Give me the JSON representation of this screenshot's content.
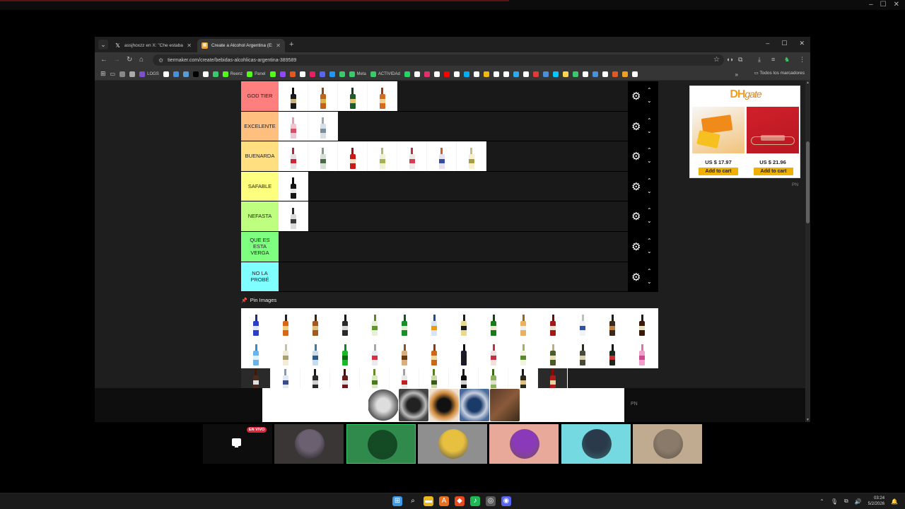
{
  "outer_window": {
    "controls": [
      "–",
      "☐",
      "✕"
    ]
  },
  "browser": {
    "tab_list_glyph": "⌄",
    "tabs": [
      {
        "favicon": "x-logo-icon",
        "title": "assjhoxzz en X: \"Che estaba al",
        "close": "✕"
      },
      {
        "favicon": "tiermaker-icon",
        "title": "Create a Alcohol Argentina (Ex",
        "close": "✕"
      }
    ],
    "new_tab": "+",
    "window_controls": {
      "minimize": "–",
      "maximize": "☐",
      "close": "✕"
    },
    "nav": {
      "back": "←",
      "forward": "→",
      "reload": "↻",
      "home": "⌂"
    },
    "url": "tiermaker.com/create/bebidas-alcohlicas-argentina-389589",
    "star": "☆",
    "bookmarks": [
      {
        "label": "",
        "color": "#888888"
      },
      {
        "label": "",
        "color": "#aaaaaa"
      },
      {
        "label": "LOGS",
        "color": "#7b52c7"
      },
      {
        "label": "",
        "color": "#ffffff"
      },
      {
        "label": "",
        "color": "#4a90d9"
      },
      {
        "label": "",
        "color": "#5b9bd5"
      },
      {
        "label": "",
        "color": "#000000"
      },
      {
        "label": "",
        "color": "#ffffff"
      },
      {
        "label": "",
        "color": "#3ac96b"
      },
      {
        "label": "Reenz",
        "color": "#53fc18"
      },
      {
        "label": "Panel",
        "color": "#53fc18"
      },
      {
        "label": "",
        "color": "#53fc18"
      },
      {
        "label": "",
        "color": "#9146ff"
      },
      {
        "label": "",
        "color": "#e25822"
      },
      {
        "label": "",
        "color": "#ffffff"
      },
      {
        "label": "",
        "color": "#e91e63"
      },
      {
        "label": "",
        "color": "#5865f2"
      },
      {
        "label": "",
        "color": "#2196f3"
      },
      {
        "label": "",
        "color": "#3ac96b"
      },
      {
        "label": "Meta",
        "color": "#3ac96b"
      },
      {
        "label": "ACTIVIDAd",
        "color": "#3ac96b"
      },
      {
        "label": "",
        "color": "#25d366"
      },
      {
        "label": "",
        "color": "#ffffff"
      },
      {
        "label": "",
        "color": "#e1306c"
      },
      {
        "label": "",
        "color": "#ffffff"
      },
      {
        "label": "",
        "color": "#ff0000"
      },
      {
        "label": "",
        "color": "#ffffff"
      },
      {
        "label": "",
        "color": "#00aff0"
      },
      {
        "label": "",
        "color": "#ffffff"
      },
      {
        "label": "",
        "color": "#f0b90b"
      },
      {
        "label": "",
        "color": "#ffffff"
      },
      {
        "label": "",
        "color": "#ffffff"
      },
      {
        "label": "",
        "color": "#2aabee"
      },
      {
        "label": "",
        "color": "#ffffff"
      },
      {
        "label": "",
        "color": "#e53935"
      },
      {
        "label": "",
        "color": "#4a90d9"
      },
      {
        "label": "",
        "color": "#00c8ff"
      },
      {
        "label": "",
        "color": "#ffd54f"
      },
      {
        "label": "",
        "color": "#3ac96b"
      },
      {
        "label": "",
        "color": "#ffffff"
      },
      {
        "label": "",
        "color": "#4a90d9"
      },
      {
        "label": "",
        "color": "#ffffff"
      },
      {
        "label": "",
        "color": "#e25822"
      },
      {
        "label": "",
        "color": "#f0a020"
      },
      {
        "label": "",
        "color": "#ffffff"
      }
    ],
    "bookmarks_overflow": "»",
    "all_bookmarks": "Todos los marcadores"
  },
  "tier_list": {
    "tiers": [
      {
        "label": "GOD TIER",
        "color": "#ff7f7f",
        "items": [
          {
            "cap": "#111111",
            "body": "#1a1a1a",
            "label": "#c9b37a"
          },
          {
            "cap": "#8a4b12",
            "body": "#c0641a",
            "label": "#d8b24a"
          },
          {
            "cap": "#123f1f",
            "body": "#1d5a2a",
            "label": "#e2c26a"
          },
          {
            "cap": "#a03a10",
            "body": "#d86a1e",
            "label": "#f0d08a"
          }
        ]
      },
      {
        "label": "EXCELENTE",
        "color": "#ffbf7f",
        "items": [
          {
            "cap": "#e0a0b0",
            "body": "#f2c4cf",
            "label": "#d84e6a"
          },
          {
            "cap": "#9aa7b4",
            "body": "#d8dee4",
            "label": "#7b8ea0"
          }
        ]
      },
      {
        "label": "BUENARDA",
        "color": "#ffdf7f",
        "items": [
          {
            "cap": "#b0283c",
            "body": "#e8e0e0",
            "label": "#c8283c"
          },
          {
            "cap": "#8a9a8a",
            "body": "#d6e0d6",
            "label": "#4a6a4a"
          },
          {
            "cap": "#a01010",
            "body": "#c81818",
            "label": "#f0e0c0"
          },
          {
            "cap": "#b0b870",
            "body": "#f0f0d8",
            "label": "#a8b050"
          },
          {
            "cap": "#c03040",
            "body": "#f0e8e8",
            "label": "#d04050"
          },
          {
            "cap": "#d06020",
            "body": "#e8e0f0",
            "label": "#3050a0"
          },
          {
            "cap": "#c8c070",
            "body": "#f4f0d0",
            "label": "#a8a040"
          }
        ]
      },
      {
        "label": "SAFABLE",
        "color": "#ffff7f",
        "items": [
          {
            "cap": "#0a0a0a",
            "body": "#151515",
            "label": "#e8e8e8"
          }
        ]
      },
      {
        "label": "NEFASTA",
        "color": "#bfff7f",
        "items": [
          {
            "cap": "#2a2a2a",
            "body": "#d8dcd8",
            "label": "#3a3a3a"
          }
        ]
      },
      {
        "label": "QUE ES ESTA VERGA",
        "color": "#7fff7f",
        "items": []
      },
      {
        "label": "NO LA PROBÉ",
        "color": "#7fffff",
        "items": []
      }
    ],
    "settings_glyph": "⚙",
    "up_glyph": "⌃",
    "down_glyph": "⌄"
  },
  "pin_images": {
    "title": "Pin Images",
    "pin_glyph": "📌",
    "rows": [
      [
        {
          "cap": "#1a2a8a",
          "body": "#2a3ec8",
          "label": "#e0e8ff"
        },
        {
          "cap": "#202020",
          "body": "#d86818",
          "label": "#f0d080"
        },
        {
          "cap": "#3a2010",
          "body": "#a05a20",
          "label": "#e0c080"
        },
        {
          "cap": "#111111",
          "body": "#2a2a2a",
          "label": "#d8d8d8"
        },
        {
          "cap": "#5a8a2a",
          "body": "#e8f0d8",
          "label": "#5a9a2a"
        },
        {
          "cap": "#0a5a1a",
          "body": "#18902a",
          "label": "#e0f0d0"
        },
        {
          "cap": "#1a4a9a",
          "body": "#d8e4f4",
          "label": "#e89a18"
        },
        {
          "cap": "#1a1a1a",
          "body": "#e8d890",
          "label": "#1a1a1a"
        },
        {
          "cap": "#0a4a0a",
          "body": "#1a7a1a",
          "label": "#f0e8d0"
        },
        {
          "cap": "#a06018",
          "body": "#e8b060",
          "label": "#f0f0f0"
        },
        {
          "cap": "#6a0a0a",
          "body": "#a01818",
          "label": "#f0e0d0"
        },
        {
          "cap": "#b8c0c8",
          "body": "#f0f4f8",
          "label": "#3050a0"
        },
        {
          "cap": "#1a1a1a",
          "body": "#3a2a1a",
          "label": "#c08040"
        },
        {
          "cap": "#1a1a1a",
          "body": "#3a1a0a",
          "label": "#e8e0c0"
        }
      ],
      [
        {
          "cap": "#3a8ac8",
          "body": "#6ab4e8",
          "label": "#e0f0ff"
        },
        {
          "cap": "#c8c0a0",
          "body": "#f0ecd8",
          "label": "#a8a070"
        },
        {
          "cap": "#3a7aa8",
          "body": "#c8dcec",
          "label": "#2a5a8a"
        },
        {
          "cap": "#0a8a1a",
          "body": "#18b82a",
          "label": "#0a6a10"
        },
        {
          "cap": "#a0a8b0",
          "body": "#e8ecf0",
          "label": "#d83040"
        },
        {
          "cap": "#8a5020",
          "body": "#d8b080",
          "label": "#6a3a10"
        },
        {
          "cap": "#8a3a0a",
          "body": "#c86818",
          "label": "#f0d8a0"
        },
        {
          "cap": "#0a0a0a",
          "body": "#1a1a2a",
          "label": "#1a1a1a"
        },
        {
          "cap": "#c03040",
          "body": "#f0e0e0",
          "label": "#c03040"
        },
        {
          "cap": "#a8b060",
          "body": "#f0f4e0",
          "label": "#5a8a2a"
        },
        {
          "cap": "#c0b078",
          "body": "#4a5a2a",
          "label": "#e8e0b0"
        },
        {
          "cap": "#2a2a1a",
          "body": "#4a4a3a",
          "label": "#d8d0b0"
        },
        {
          "cap": "#0a0a0a",
          "body": "#1a2a1a",
          "label": "#c83030"
        },
        {
          "cap": "#e070a8",
          "body": "#f0a0c8",
          "label": "#d04890"
        }
      ],
      [
        {
          "cap": "#3a1a0a",
          "body": "#4a2a1a",
          "label": "#e0e0e0"
        },
        {
          "cap": "#8a9aaa",
          "body": "#e0e8f0",
          "label": "#3a4a8a"
        },
        {
          "cap": "#1a1a1a",
          "body": "#2a2a2a",
          "label": "#d0d0d0"
        },
        {
          "cap": "#3a0a0a",
          "body": "#6a1a1a",
          "label": "#e0e0e0"
        },
        {
          "cap": "#6a8a2a",
          "body": "#d8e8c0",
          "label": "#4a7a1a"
        },
        {
          "cap": "#a0a0a0",
          "body": "#e8e8e8",
          "label": "#c02020"
        },
        {
          "cap": "#5a7a2a",
          "body": "#c8d8a8",
          "label": "#3a5a1a"
        },
        {
          "cap": "#1a1a1a",
          "body": "#0a0a0a",
          "label": "#d0d0d0"
        },
        {
          "cap": "#3a6a1a",
          "body": "#8ab058",
          "label": "#e0e0d0"
        },
        {
          "cap": "#1a1a1a",
          "body": "#2a2a1a",
          "label": "#e0c080"
        },
        {
          "cap": "#8a0a0a",
          "body": "#b01a1a",
          "label": "#e8d0a0"
        }
      ]
    ]
  },
  "side_ad": {
    "brand": "DH",
    "brand_suffix": "gate",
    "products": [
      {
        "price": "US $ 17.97",
        "cta": "Add to cart"
      },
      {
        "price": "US $ 21.96",
        "cta": "Add to cart"
      }
    ],
    "badge": "PN"
  },
  "bottom_ad": {
    "badge": "PN"
  },
  "call": {
    "live_badge": "EN VIVO",
    "participants": [
      {
        "bg": "#0d0d0d",
        "avatar": "#0d0d0d",
        "type": "screen-share"
      },
      {
        "bg": "#3a3636",
        "avatar": "#6a6070"
      },
      {
        "bg": "#2f8a4c",
        "avatar": "#144a24",
        "selected": true
      },
      {
        "bg": "#8f8f8f",
        "avatar": "#e8c040"
      },
      {
        "bg": "#e8a89a",
        "avatar": "#8a3ab8"
      },
      {
        "bg": "#74d9e0",
        "avatar": "#2a3a4a"
      },
      {
        "bg": "#c0aa90",
        "avatar": "#8a7a6a"
      }
    ]
  },
  "taskbar": {
    "apps": [
      {
        "name": "windows-start-icon",
        "color": "#3a9ae8",
        "glyph": "⊞"
      },
      {
        "name": "search-icon",
        "color": "transparent",
        "glyph": "⌕"
      },
      {
        "name": "file-explorer-icon",
        "color": "#e8b820",
        "glyph": "▬"
      },
      {
        "name": "app-orange-icon",
        "color": "#e87020",
        "glyph": "A"
      },
      {
        "name": "brave-icon",
        "color": "#e84a20",
        "glyph": "◆"
      },
      {
        "name": "spotify-icon",
        "color": "#1db954",
        "glyph": "♪"
      },
      {
        "name": "app-ring-icon",
        "color": "#5a5a5a",
        "glyph": "◎"
      },
      {
        "name": "discord-icon",
        "color": "#5865f2",
        "glyph": "◉"
      }
    ],
    "tray": [
      "⌃",
      "🎙",
      "⧉",
      "🔊"
    ],
    "time": "03:24",
    "date": "5/2/2026",
    "bell": "🔔"
  }
}
